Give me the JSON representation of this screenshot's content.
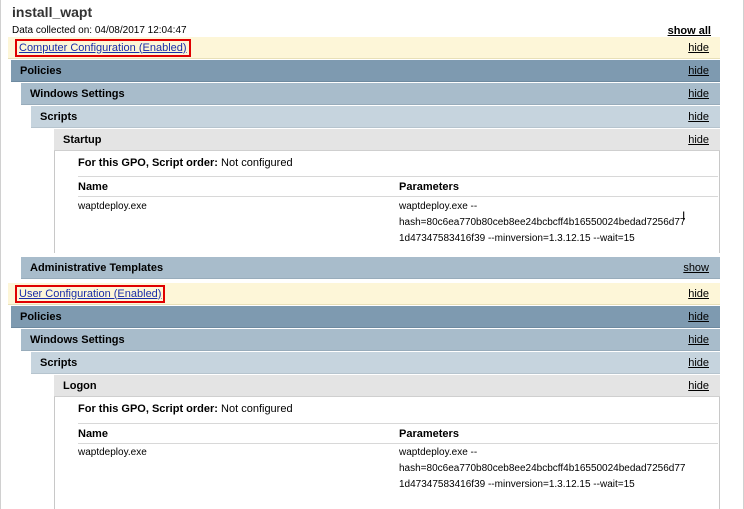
{
  "header": {
    "title": "install_wapt",
    "collected": "Data collected on: 04/08/2017 12:04:47",
    "show_all": "show all"
  },
  "computer": {
    "label": "Computer Configuration (Enabled)",
    "toggle": "hide",
    "policies": {
      "label": "Policies",
      "toggle": "hide"
    },
    "windows_settings": {
      "label": "Windows Settings",
      "toggle": "hide"
    },
    "scripts": {
      "label": "Scripts",
      "toggle": "hide"
    },
    "startup": {
      "label": "Startup",
      "toggle": "hide"
    },
    "order_prefix": "For this GPO, Script order:",
    "order_value": "Not configured",
    "table": {
      "col_name": "Name",
      "col_params": "Parameters",
      "row_name": "waptdeploy.exe",
      "row_params_1": "waptdeploy.exe --",
      "row_params_2": "hash=80c6ea770b80ceb8ee24bcbcff4b16550024bedad7256d77",
      "row_params_3": "1d47347583416f39 --minversion=1.3.12.15 --wait=15"
    },
    "admin_templates": {
      "label": "Administrative Templates",
      "toggle": "show"
    }
  },
  "user": {
    "label": "User Configuration (Enabled)",
    "toggle": "hide",
    "policies": {
      "label": "Policies",
      "toggle": "hide"
    },
    "windows_settings": {
      "label": "Windows Settings",
      "toggle": "hide"
    },
    "scripts": {
      "label": "Scripts",
      "toggle": "hide"
    },
    "logon": {
      "label": "Logon",
      "toggle": "hide"
    },
    "order_prefix": "For this GPO, Script order:",
    "order_value": "Not configured",
    "table": {
      "col_name": "Name",
      "col_params": "Parameters",
      "row_name": "waptdeploy.exe",
      "row_params_1": "waptdeploy.exe --",
      "row_params_2": "hash=80c6ea770b80ceb8ee24bcbcff4b16550024bedad7256d77",
      "row_params_3": "1d47347583416f39 --minversion=1.3.12.15 --wait=15"
    }
  },
  "colors": {
    "config_bg": "#fdf6d8",
    "level1": "#7e9ab0",
    "level2": "#a8bccb",
    "level3": "#c6d4de",
    "level4": "#e4e4e4",
    "highlight_box": "#e00000",
    "link": "#1a2da8"
  },
  "icons": {
    "cursor": "text-cursor-icon"
  }
}
